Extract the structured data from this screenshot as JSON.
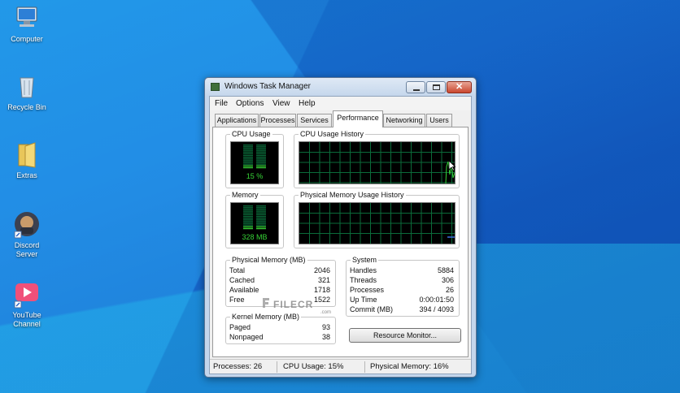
{
  "desktop": {
    "icons": [
      {
        "label": "Computer",
        "icon": "computer-icon"
      },
      {
        "label": "Recycle Bin",
        "icon": "recycle-bin-icon"
      },
      {
        "label": "Extras",
        "icon": "folder-icon"
      },
      {
        "label_line1": "Discord",
        "label_line2": "Server",
        "icon": "discord-icon"
      },
      {
        "label_line1": "YouTube",
        "label_line2": "Channel",
        "icon": "youtube-icon"
      }
    ]
  },
  "window": {
    "title": "Windows Task Manager",
    "menu": [
      "File",
      "Options",
      "View",
      "Help"
    ],
    "tabs": [
      "Applications",
      "Processes",
      "Services",
      "Performance",
      "Networking",
      "Users"
    ],
    "active_tab": "Performance",
    "cpu_usage": {
      "label": "CPU Usage",
      "value": "15 %",
      "level": 0.15
    },
    "cpu_history": {
      "label": "CPU Usage History"
    },
    "memory": {
      "label": "Memory",
      "value": "328 MB",
      "level": 0.16
    },
    "memory_history": {
      "label": "Physical Memory Usage History"
    },
    "physical_memory": {
      "label": "Physical Memory (MB)",
      "rows": [
        {
          "key": "Total",
          "value": "2046"
        },
        {
          "key": "Cached",
          "value": "321"
        },
        {
          "key": "Available",
          "value": "1718"
        },
        {
          "key": "Free",
          "value": "1522"
        }
      ]
    },
    "kernel_memory": {
      "label": "Kernel Memory (MB)",
      "rows": [
        {
          "key": "Paged",
          "value": "93"
        },
        {
          "key": "Nonpaged",
          "value": "38"
        }
      ]
    },
    "system": {
      "label": "System",
      "rows": [
        {
          "key": "Handles",
          "value": "5884"
        },
        {
          "key": "Threads",
          "value": "306"
        },
        {
          "key": "Processes",
          "value": "26"
        },
        {
          "key": "Up Time",
          "value": "0:00:01:50"
        },
        {
          "key": "Commit (MB)",
          "value": "394 / 4093"
        }
      ]
    },
    "resource_monitor_button": "Resource Monitor...",
    "status": {
      "processes": "Processes: 26",
      "cpu": "CPU Usage: 15%",
      "memory": "Physical Memory: 16%"
    }
  },
  "watermark": {
    "text": "FILECR",
    "sub": ".com"
  },
  "colors": {
    "graph_green": "#37d437",
    "grid_green": "#0b6b3a",
    "graph_bg": "#000000"
  }
}
